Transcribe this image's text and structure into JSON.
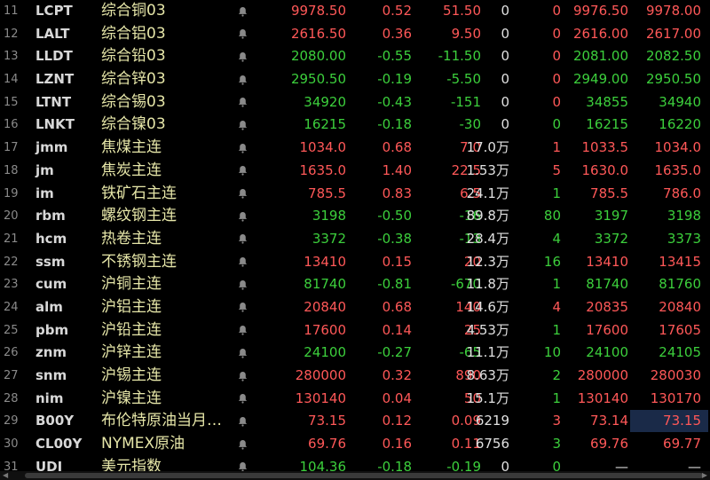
{
  "colors": {
    "up": "#ff5858",
    "down": "#3ccf3c",
    "flat": "#e0e0e0",
    "name": "#e6e6a8",
    "highlight": "#1a2a48"
  },
  "scrollbar": {
    "left_arrow": "◀",
    "right_arrow": "▶"
  },
  "rows": [
    {
      "num": "11",
      "code": "LCPT",
      "name": "综合铜03",
      "last": "9978.50",
      "pct": "0.52",
      "chg": "51.50",
      "vol": "0",
      "cur": "0",
      "bid": "9976.50",
      "ask": "9978.00",
      "dir": "up",
      "cur_dir": "up",
      "bid_dir": "up",
      "ask_dir": "up"
    },
    {
      "num": "12",
      "code": "LALT",
      "name": "综合铝03",
      "last": "2616.50",
      "pct": "0.36",
      "chg": "9.50",
      "vol": "0",
      "cur": "0",
      "bid": "2616.00",
      "ask": "2617.00",
      "dir": "up",
      "cur_dir": "up",
      "bid_dir": "up",
      "ask_dir": "up"
    },
    {
      "num": "13",
      "code": "LLDT",
      "name": "综合铅03",
      "last": "2080.00",
      "pct": "-0.55",
      "chg": "-11.50",
      "vol": "0",
      "cur": "0",
      "bid": "2081.00",
      "ask": "2082.50",
      "dir": "down",
      "cur_dir": "up",
      "bid_dir": "down",
      "ask_dir": "down"
    },
    {
      "num": "14",
      "code": "LZNT",
      "name": "综合锌03",
      "last": "2950.50",
      "pct": "-0.19",
      "chg": "-5.50",
      "vol": "0",
      "cur": "0",
      "bid": "2949.00",
      "ask": "2950.50",
      "dir": "down",
      "cur_dir": "up",
      "bid_dir": "down",
      "ask_dir": "down"
    },
    {
      "num": "15",
      "code": "LTNT",
      "name": "综合锡03",
      "last": "34920",
      "pct": "-0.43",
      "chg": "-151",
      "vol": "0",
      "cur": "0",
      "bid": "34855",
      "ask": "34940",
      "dir": "down",
      "cur_dir": "up",
      "bid_dir": "down",
      "ask_dir": "down"
    },
    {
      "num": "16",
      "code": "LNKT",
      "name": "综合镍03",
      "last": "16215",
      "pct": "-0.18",
      "chg": "-30",
      "vol": "0",
      "cur": "0",
      "bid": "16215",
      "ask": "16220",
      "dir": "down",
      "cur_dir": "down",
      "bid_dir": "down",
      "ask_dir": "down"
    },
    {
      "num": "17",
      "code": "jmm",
      "name": "焦煤主连",
      "last": "1034.0",
      "pct": "0.68",
      "chg": "7.0",
      "vol": "17.0",
      "vol_unit": "万",
      "cur": "1",
      "bid": "1033.5",
      "ask": "1034.0",
      "dir": "up",
      "cur_dir": "up",
      "bid_dir": "up",
      "ask_dir": "up"
    },
    {
      "num": "18",
      "code": "jm",
      "name": "焦炭主连",
      "last": "1635.0",
      "pct": "1.40",
      "chg": "22.5",
      "vol": "1.53",
      "vol_unit": "万",
      "cur": "5",
      "bid": "1630.0",
      "ask": "1635.0",
      "dir": "up",
      "cur_dir": "up",
      "bid_dir": "up",
      "ask_dir": "up"
    },
    {
      "num": "19",
      "code": "im",
      "name": "铁矿石主连",
      "last": "785.5",
      "pct": "0.83",
      "chg": "6.5",
      "vol": "24.1",
      "vol_unit": "万",
      "cur": "1",
      "bid": "785.5",
      "ask": "786.0",
      "dir": "up",
      "cur_dir": "down",
      "bid_dir": "up",
      "ask_dir": "up"
    },
    {
      "num": "20",
      "code": "rbm",
      "name": "螺纹钢主连",
      "last": "3198",
      "pct": "-0.50",
      "chg": "-16",
      "vol": "89.8",
      "vol_unit": "万",
      "cur": "80",
      "bid": "3197",
      "ask": "3198",
      "dir": "down",
      "cur_dir": "down",
      "bid_dir": "down",
      "ask_dir": "down"
    },
    {
      "num": "21",
      "code": "hcm",
      "name": "热卷主连",
      "last": "3372",
      "pct": "-0.38",
      "chg": "-13",
      "vol": "28.4",
      "vol_unit": "万",
      "cur": "4",
      "bid": "3372",
      "ask": "3373",
      "dir": "down",
      "cur_dir": "down",
      "bid_dir": "down",
      "ask_dir": "down"
    },
    {
      "num": "22",
      "code": "ssm",
      "name": "不锈钢主连",
      "last": "13410",
      "pct": "0.15",
      "chg": "20",
      "vol": "12.3",
      "vol_unit": "万",
      "cur": "16",
      "bid": "13410",
      "ask": "13415",
      "dir": "up",
      "cur_dir": "down",
      "bid_dir": "up",
      "ask_dir": "up"
    },
    {
      "num": "23",
      "code": "cum",
      "name": "沪铜主连",
      "last": "81740",
      "pct": "-0.81",
      "chg": "-670",
      "vol": "11.8",
      "vol_unit": "万",
      "cur": "1",
      "bid": "81740",
      "ask": "81760",
      "dir": "down",
      "cur_dir": "down",
      "bid_dir": "down",
      "ask_dir": "down"
    },
    {
      "num": "24",
      "code": "alm",
      "name": "沪铝主连",
      "last": "20840",
      "pct": "0.68",
      "chg": "140",
      "vol": "14.6",
      "vol_unit": "万",
      "cur": "4",
      "bid": "20835",
      "ask": "20840",
      "dir": "up",
      "cur_dir": "up",
      "bid_dir": "up",
      "ask_dir": "up"
    },
    {
      "num": "25",
      "code": "pbm",
      "name": "沪铅主连",
      "last": "17600",
      "pct": "0.14",
      "chg": "25",
      "vol": "4.53",
      "vol_unit": "万",
      "cur": "1",
      "bid": "17600",
      "ask": "17605",
      "dir": "up",
      "cur_dir": "down",
      "bid_dir": "up",
      "ask_dir": "up"
    },
    {
      "num": "26",
      "code": "znm",
      "name": "沪锌主连",
      "last": "24100",
      "pct": "-0.27",
      "chg": "-65",
      "vol": "11.1",
      "vol_unit": "万",
      "cur": "10",
      "bid": "24100",
      "ask": "24105",
      "dir": "down",
      "cur_dir": "down",
      "bid_dir": "down",
      "ask_dir": "down"
    },
    {
      "num": "27",
      "code": "snm",
      "name": "沪锡主连",
      "last": "280000",
      "pct": "0.32",
      "chg": "890",
      "vol": "8.63",
      "vol_unit": "万",
      "cur": "2",
      "bid": "280000",
      "ask": "280030",
      "dir": "up",
      "cur_dir": "down",
      "bid_dir": "up",
      "ask_dir": "up"
    },
    {
      "num": "28",
      "code": "nim",
      "name": "沪镍主连",
      "last": "130140",
      "pct": "0.04",
      "chg": "50",
      "vol": "15.1",
      "vol_unit": "万",
      "cur": "1",
      "bid": "130140",
      "ask": "130170",
      "dir": "up",
      "cur_dir": "down",
      "bid_dir": "up",
      "ask_dir": "up"
    },
    {
      "num": "29",
      "code": "B00Y",
      "name": "布伦特原油当月…",
      "last": "73.15",
      "pct": "0.12",
      "chg": "0.09",
      "vol": "6219",
      "cur": "3",
      "bid": "73.14",
      "ask": "73.15",
      "dir": "up",
      "cur_dir": "up",
      "bid_dir": "up",
      "ask_dir": "up",
      "highlight_ask": true
    },
    {
      "num": "30",
      "code": "CL00Y",
      "name": "NYMEX原油",
      "last": "69.76",
      "pct": "0.16",
      "chg": "0.11",
      "vol": "6756",
      "cur": "3",
      "bid": "69.76",
      "ask": "69.77",
      "dir": "up",
      "cur_dir": "down",
      "bid_dir": "up",
      "ask_dir": "up"
    },
    {
      "num": "31",
      "code": "UDI",
      "name": "美元指数",
      "last": "104.36",
      "pct": "-0.18",
      "chg": "-0.19",
      "vol": "0",
      "cur": "0",
      "bid": "—",
      "ask": "—",
      "dir": "down",
      "cur_dir": "down",
      "bid_dir": "flat",
      "ask_dir": "flat"
    }
  ]
}
